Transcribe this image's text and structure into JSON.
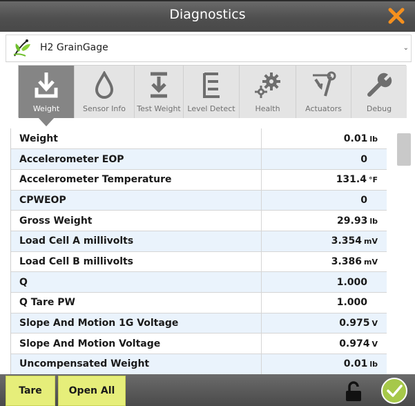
{
  "window": {
    "title": "Diagnostics"
  },
  "device": {
    "name": "H2 GrainGage"
  },
  "tabs": [
    {
      "label": "Weight",
      "icon": "download-icon",
      "active": true
    },
    {
      "label": "Sensor Info",
      "icon": "droplet-icon",
      "active": false
    },
    {
      "label": "Test Weight",
      "icon": "test-weight-icon",
      "active": false
    },
    {
      "label": "Level Detect",
      "icon": "level-detect-icon",
      "active": false
    },
    {
      "label": "Health",
      "icon": "gears-icon",
      "active": false
    },
    {
      "label": "Actuators",
      "icon": "actuator-icon",
      "active": false
    },
    {
      "label": "Debug",
      "icon": "wrench-icon",
      "active": false
    }
  ],
  "rows": [
    {
      "label": "Weight",
      "value": "0.01",
      "unit": "lb"
    },
    {
      "label": "Accelerometer EOP",
      "value": "0",
      "unit": ""
    },
    {
      "label": "Accelerometer Temperature",
      "value": "131.4",
      "unit": "°F"
    },
    {
      "label": "CPWEOP",
      "value": "0",
      "unit": ""
    },
    {
      "label": "Gross Weight",
      "value": "29.93",
      "unit": "lb"
    },
    {
      "label": "Load Cell A millivolts",
      "value": "3.354",
      "unit": "mV"
    },
    {
      "label": "Load Cell B millivolts",
      "value": "3.386",
      "unit": "mV"
    },
    {
      "label": "Q",
      "value": "1.000",
      "unit": ""
    },
    {
      "label": "Q Tare PW",
      "value": "1.000",
      "unit": ""
    },
    {
      "label": "Slope And Motion 1G Voltage",
      "value": "0.975",
      "unit": "V"
    },
    {
      "label": "Slope And Motion Voltage",
      "value": "0.974",
      "unit": "V"
    },
    {
      "label": "Uncompensated Weight",
      "value": "0.01",
      "unit": "lb"
    }
  ],
  "buttons": {
    "tare": "Tare",
    "open_all": "Open All"
  },
  "colors": {
    "accent_close": "#f5901e",
    "button_bg": "#e6ee7a",
    "ok_green": "#a6c84a",
    "active_tab": "#858585"
  }
}
